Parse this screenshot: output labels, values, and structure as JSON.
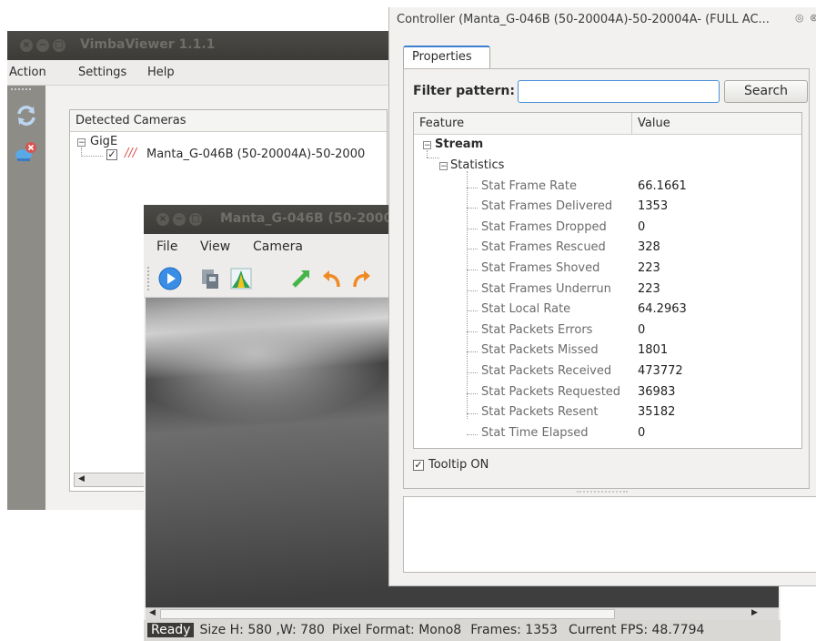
{
  "main_window": {
    "title": "VimbaViewer 1.1.1",
    "menu": [
      "Action",
      "Settings",
      "Help"
    ],
    "cameras_header": "Detected Cameras",
    "tree": {
      "group": "GigE",
      "camera_label": "Manta_G-046B (50-20004A)-50-2000",
      "camera_mark": "///"
    }
  },
  "camera_window": {
    "title": "Manta_G-046B (50-2000",
    "menu": [
      "File",
      "View",
      "Camera"
    ],
    "toolbar_icons": [
      "play-icon",
      "save-image-icon",
      "histogram-icon",
      "rotate-icon",
      "undo-icon",
      "redo-icon"
    ],
    "status": {
      "ready": "Ready",
      "size": "Size H: 580 ,W: 780",
      "pixel_format": "Pixel Format: Mono8",
      "frames": "Frames: 1353",
      "fps": "Current FPS: 48.7794"
    }
  },
  "controller_window": {
    "title": "Controller  (Manta_G-046B (50-20004A)-50-20004A- (FULL AC...",
    "tab": "Properties",
    "filter_label": "Filter pattern:",
    "filter_value": "",
    "search_button": "Search",
    "columns": [
      "Feature",
      "Value"
    ],
    "category": "Stream",
    "subcategory": "Statistics",
    "rows": [
      {
        "feature": "Stat Frame Rate",
        "value": "66.1661"
      },
      {
        "feature": "Stat Frames Delivered",
        "value": "1353"
      },
      {
        "feature": "Stat Frames Dropped",
        "value": "0"
      },
      {
        "feature": "Stat Frames Rescued",
        "value": "328"
      },
      {
        "feature": "Stat Frames Shoved",
        "value": "223"
      },
      {
        "feature": "Stat Frames Underrun",
        "value": "223"
      },
      {
        "feature": "Stat Local Rate",
        "value": "64.2963"
      },
      {
        "feature": "Stat Packets Errors",
        "value": "0"
      },
      {
        "feature": "Stat Packets Missed",
        "value": "1801"
      },
      {
        "feature": "Stat Packets Received",
        "value": "473772"
      },
      {
        "feature": "Stat Packets Requested",
        "value": "36983"
      },
      {
        "feature": "Stat Packets Resent",
        "value": "35182"
      },
      {
        "feature": "Stat Time Elapsed",
        "value": "0"
      }
    ],
    "tooltip_label": "Tooltip ON",
    "tooltip_checked": true
  },
  "colors": {
    "titlebar": "#3c3b37",
    "accent": "#3d7fd1",
    "status_ready_bg": "#3c3b37",
    "camera_mark": "#d9534f"
  }
}
